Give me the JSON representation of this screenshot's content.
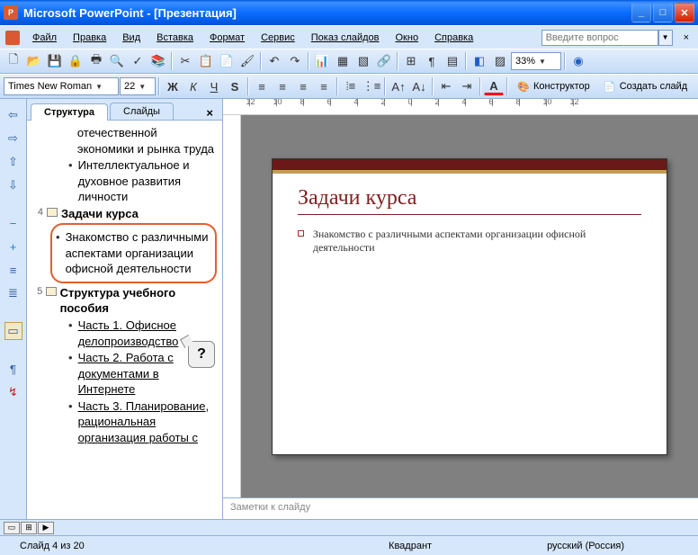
{
  "window": {
    "title": "Microsoft PowerPoint - [Презентация]"
  },
  "menu": {
    "items": [
      "Файл",
      "Правка",
      "Вид",
      "Вставка",
      "Формат",
      "Сервис",
      "Показ слайдов",
      "Окно",
      "Справка"
    ],
    "help_placeholder": "Введите вопрос"
  },
  "toolbar1": {
    "zoom": "33%"
  },
  "toolbar2": {
    "font": "Times New Roman",
    "size": "22",
    "designer": "Конструктор",
    "new_slide": "Создать слайд"
  },
  "tabs": {
    "outline": "Структура",
    "slides": "Слайды"
  },
  "outline": {
    "pre_bullets": [
      "отечественной экономики и рынка труда",
      "Интеллектуальное и духовное развития личности"
    ],
    "slide4": {
      "num": "4",
      "title": "Задачи курса",
      "bullet": "Знакомство с различными аспектами организации офисной деятельности"
    },
    "slide5": {
      "num": "5",
      "title": "Структура учебного пособия",
      "bullets": [
        "Часть 1. Офисное делопроизводство",
        "Часть 2. Работа с документами в Интернете",
        "Часть 3. Планирование, рациональная организация работы с"
      ]
    },
    "qmark": "?"
  },
  "slide": {
    "title": "Задачи курса",
    "bullet": "Знакомство с различными аспектами организации офисной деятельности"
  },
  "notes": {
    "placeholder": "Заметки к слайду"
  },
  "status": {
    "slide": "Слайд 4 из 20",
    "layout": "Квадрант",
    "lang": "русский (Россия)"
  }
}
